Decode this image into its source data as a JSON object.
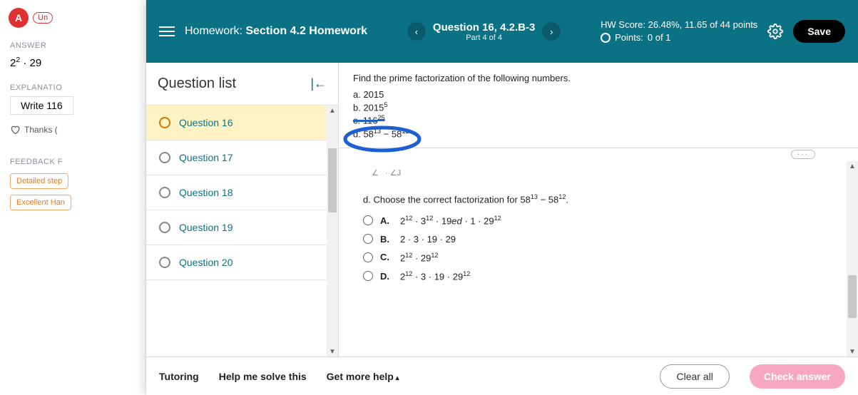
{
  "background": {
    "avatar_letter": "A",
    "un_label": "Un",
    "answer_label": "ANSWER",
    "answer_value_html": "2<sup>2</sup> · 29",
    "explanation_label": "EXPLANATIO",
    "write_label": "Write 116",
    "thanks_label": "Thanks (",
    "feedback_label": "FEEDBACK F",
    "fb1": "Detailed step",
    "fb2": "Excellent Han"
  },
  "header": {
    "hw_prefix": "Homework:",
    "hw_title": "Section 4.2 Homework",
    "question_title": "Question 16, 4.2.B-3",
    "part_label": "Part 4 of 4",
    "score_prefix": "HW Score:",
    "score_value": "26.48%, 11.65 of 44 points",
    "points_prefix": "Points:",
    "points_value": "0 of 1",
    "save_label": "Save"
  },
  "qlist": {
    "title": "Question list",
    "items": [
      {
        "label": "Question 16",
        "active": true
      },
      {
        "label": "Question 17",
        "active": false
      },
      {
        "label": "Question 18",
        "active": false
      },
      {
        "label": "Question 19",
        "active": false
      },
      {
        "label": "Question 20",
        "active": false
      }
    ]
  },
  "prompt": {
    "text": "Find the prime factorization of the following numbers.",
    "a": "a. 2015",
    "b_html": "b. 2015<sup>5</sup>",
    "c_html": "c. 116<sup>25</sup>",
    "d_html": "d. 58<sup>13</sup> − 58<sup>12</sup>"
  },
  "answers": {
    "question_html": "d. Choose the correct factorization for 58<sup>13</sup> − 58<sup>12</sup>.",
    "options": [
      {
        "letter": "A.",
        "expr_html": "2<sup>12</sup> · 3<sup>12</sup> · 19<i>ed</i> · 1 · 29<sup>12</sup>"
      },
      {
        "letter": "B.",
        "expr_html": "2 · 3 · 19 · 29"
      },
      {
        "letter": "C.",
        "expr_html": "2<sup>12</sup> · 29<sup>12</sup>"
      },
      {
        "letter": "D.",
        "expr_html": "2<sup>12</sup> · 3 · 19 · 29<sup>12</sup>"
      }
    ]
  },
  "footer": {
    "tutoring": "Tutoring",
    "help": "Help me solve this",
    "more": "Get more help",
    "clear": "Clear all",
    "check": "Check answer"
  }
}
